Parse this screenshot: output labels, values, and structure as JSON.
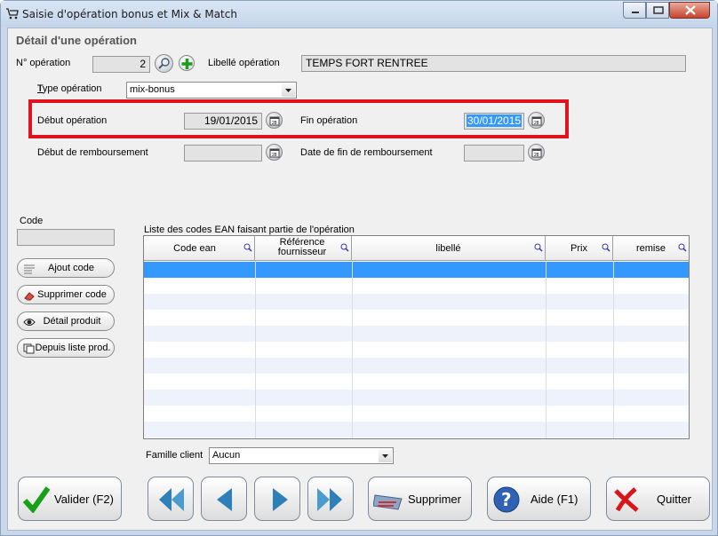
{
  "window": {
    "title": "Saisie d'opération bonus et Mix & Match"
  },
  "section_title": "Détail d'une opération",
  "operation": {
    "number_label": "N° opération",
    "number_value": "2",
    "libelle_label": "Libellé opération",
    "libelle_value": "TEMPS FORT RENTREE",
    "type_label": "Type opération",
    "type_value": "mix-bonus",
    "debut_label": "Début opération",
    "debut_value": "19/01/2015",
    "fin_label": "Fin opération",
    "fin_value": "30/01/2015",
    "debut_remb_label": "Début de remboursement",
    "debut_remb_value": "",
    "fin_remb_label": "Date de fin de remboursement",
    "fin_remb_value": ""
  },
  "code": {
    "label": "Code",
    "value": ""
  },
  "side_buttons": {
    "ajout": "Ajout code",
    "supprimer": "Supprimer code",
    "detail": "Détail produit",
    "depuis": "Depuis liste prod."
  },
  "grid": {
    "caption": "Liste des codes EAN faisant partie de l'opération",
    "columns": [
      "Code ean",
      "Référence fournisseur",
      "libellé",
      "Prix",
      "remise"
    ],
    "rows": []
  },
  "famille": {
    "label": "Famille client",
    "value": "Aucun"
  },
  "bottom_buttons": {
    "valider": "Valider (F2)",
    "supprimer": "Supprimer",
    "aide": "Aide (F1)",
    "quitter": "Quitter"
  },
  "colors": {
    "highlight_border": "#e0141e",
    "selected_row": "#3399ff",
    "selected_text": "#3399ff"
  }
}
